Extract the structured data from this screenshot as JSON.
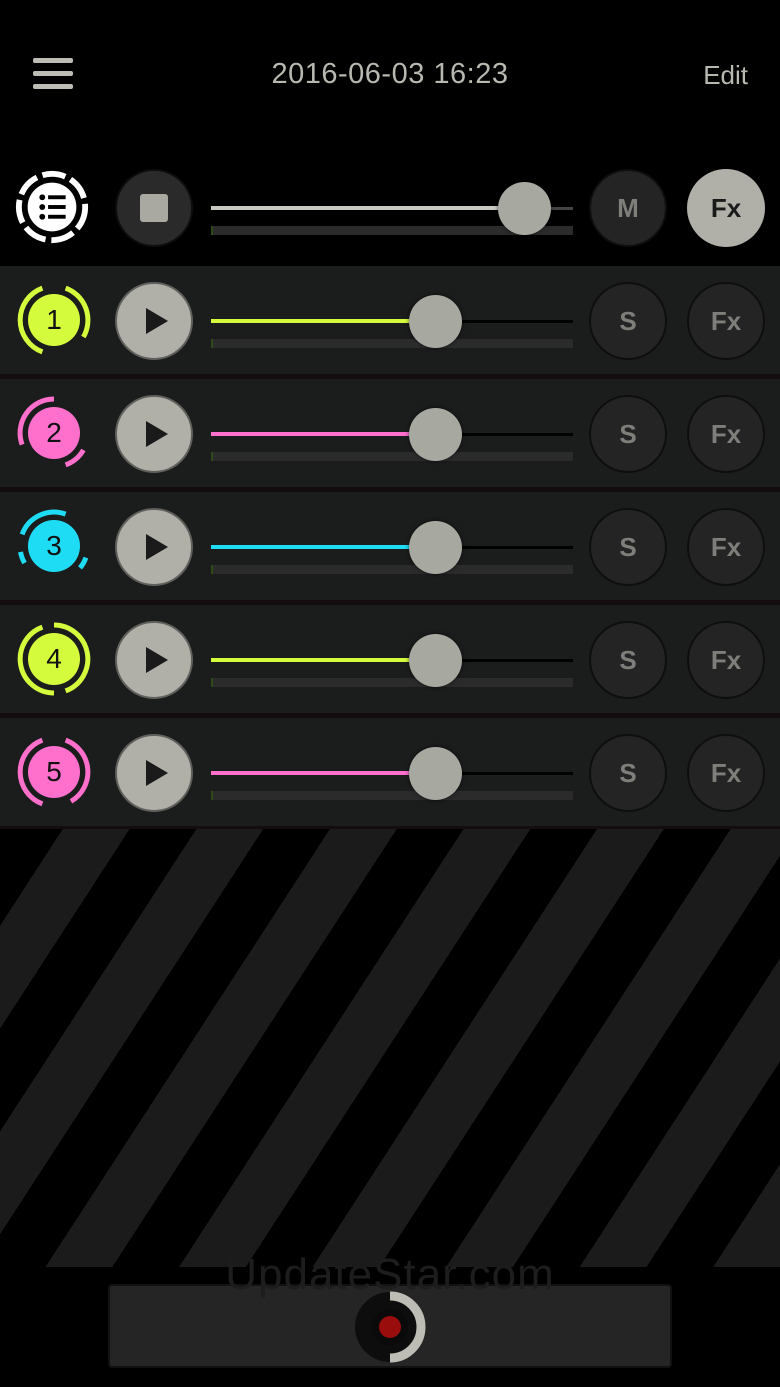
{
  "header": {
    "title": "2016-06-03 16:23",
    "edit_label": "Edit"
  },
  "master": {
    "mute_label": "M",
    "fx_label": "Fx",
    "volume": 0.93
  },
  "tracks": [
    {
      "number": "1",
      "color": "#d4fc3d",
      "solo_label": "S",
      "fx_label": "Fx",
      "volume": 0.64
    },
    {
      "number": "2",
      "color": "#ff6fcc",
      "solo_label": "S",
      "fx_label": "Fx",
      "volume": 0.64
    },
    {
      "number": "3",
      "color": "#1fdcf5",
      "solo_label": "S",
      "fx_label": "Fx",
      "volume": 0.64
    },
    {
      "number": "4",
      "color": "#d4fc3d",
      "solo_label": "S",
      "fx_label": "Fx",
      "volume": 0.64
    },
    {
      "number": "5",
      "color": "#ff6fcc",
      "solo_label": "S",
      "fx_label": "Fx",
      "volume": 0.64
    }
  ],
  "footer": {
    "watermark": "UpdateStar.com",
    "record_color": "#9a0d0d"
  },
  "icons": {
    "menu": "menu-icon",
    "tracklist": "tracklist-icon",
    "stop": "stop-icon",
    "play": "play-icon",
    "record": "record-icon"
  }
}
